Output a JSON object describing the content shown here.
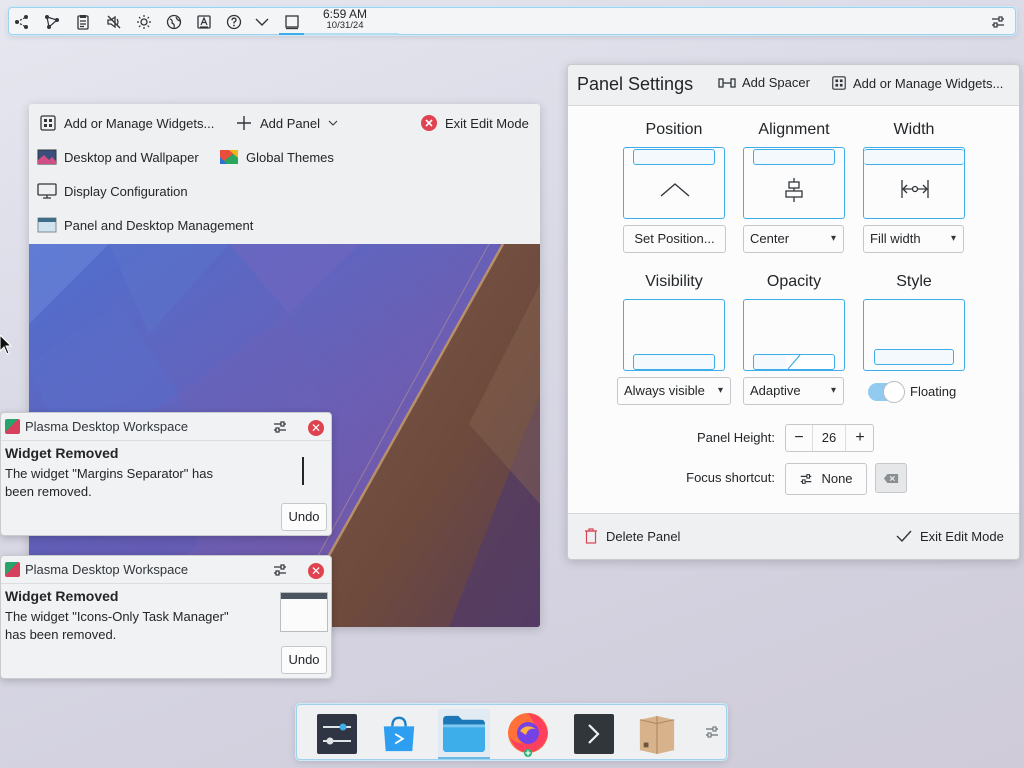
{
  "top_panel": {
    "clock_time": "6:59 AM",
    "clock_date": "10/31/24",
    "icons": [
      "graph-icon",
      "network-graph-icon",
      "clipboard-icon",
      "volume-muted-icon",
      "brightness-icon",
      "globe-icon",
      "input-method-icon",
      "help-icon",
      "expand-tray-icon",
      "show-desktop-icon"
    ]
  },
  "toolbox": {
    "add_widgets": "Add or Manage Widgets...",
    "add_panel": "Add Panel",
    "exit_edit": "Exit Edit Mode",
    "desktop_wallpaper": "Desktop and Wallpaper",
    "global_themes": "Global Themes",
    "display_config": "Display Configuration",
    "panel_desktop_mgmt": "Panel and Desktop Management"
  },
  "notifications": [
    {
      "app": "Plasma Desktop Workspace",
      "title": "Widget Removed",
      "body": "The widget \"Margins Separator\" has been removed.",
      "undo": "Undo"
    },
    {
      "app": "Plasma Desktop Workspace",
      "title": "Widget Removed",
      "body": "The widget \"Icons-Only Task Manager\" has been removed.",
      "undo": "Undo"
    }
  ],
  "settings": {
    "title": "Panel Settings",
    "add_spacer": "Add Spacer",
    "add_widgets": "Add or Manage Widgets...",
    "position_label": "Position",
    "alignment_label": "Alignment",
    "width_label": "Width",
    "position_button": "Set Position...",
    "alignment_value": "Center",
    "width_value": "Fill width",
    "visibility_label": "Visibility",
    "opacity_label": "Opacity",
    "style_label": "Style",
    "visibility_value": "Always visible",
    "opacity_value": "Adaptive",
    "style_value": "Floating",
    "floating_enabled": true,
    "panel_height_label": "Panel Height:",
    "panel_height": "26",
    "focus_shortcut_label": "Focus shortcut:",
    "focus_shortcut": "None",
    "delete_panel": "Delete Panel",
    "exit_edit": "Exit Edit Mode"
  },
  "dock": {
    "items": [
      "system-settings",
      "discover",
      "file-manager",
      "firefox",
      "terminal",
      "archive-manager"
    ],
    "active_item": "file-manager"
  },
  "colors": {
    "accent": "#3daee9",
    "close_red": "#e0434f"
  }
}
